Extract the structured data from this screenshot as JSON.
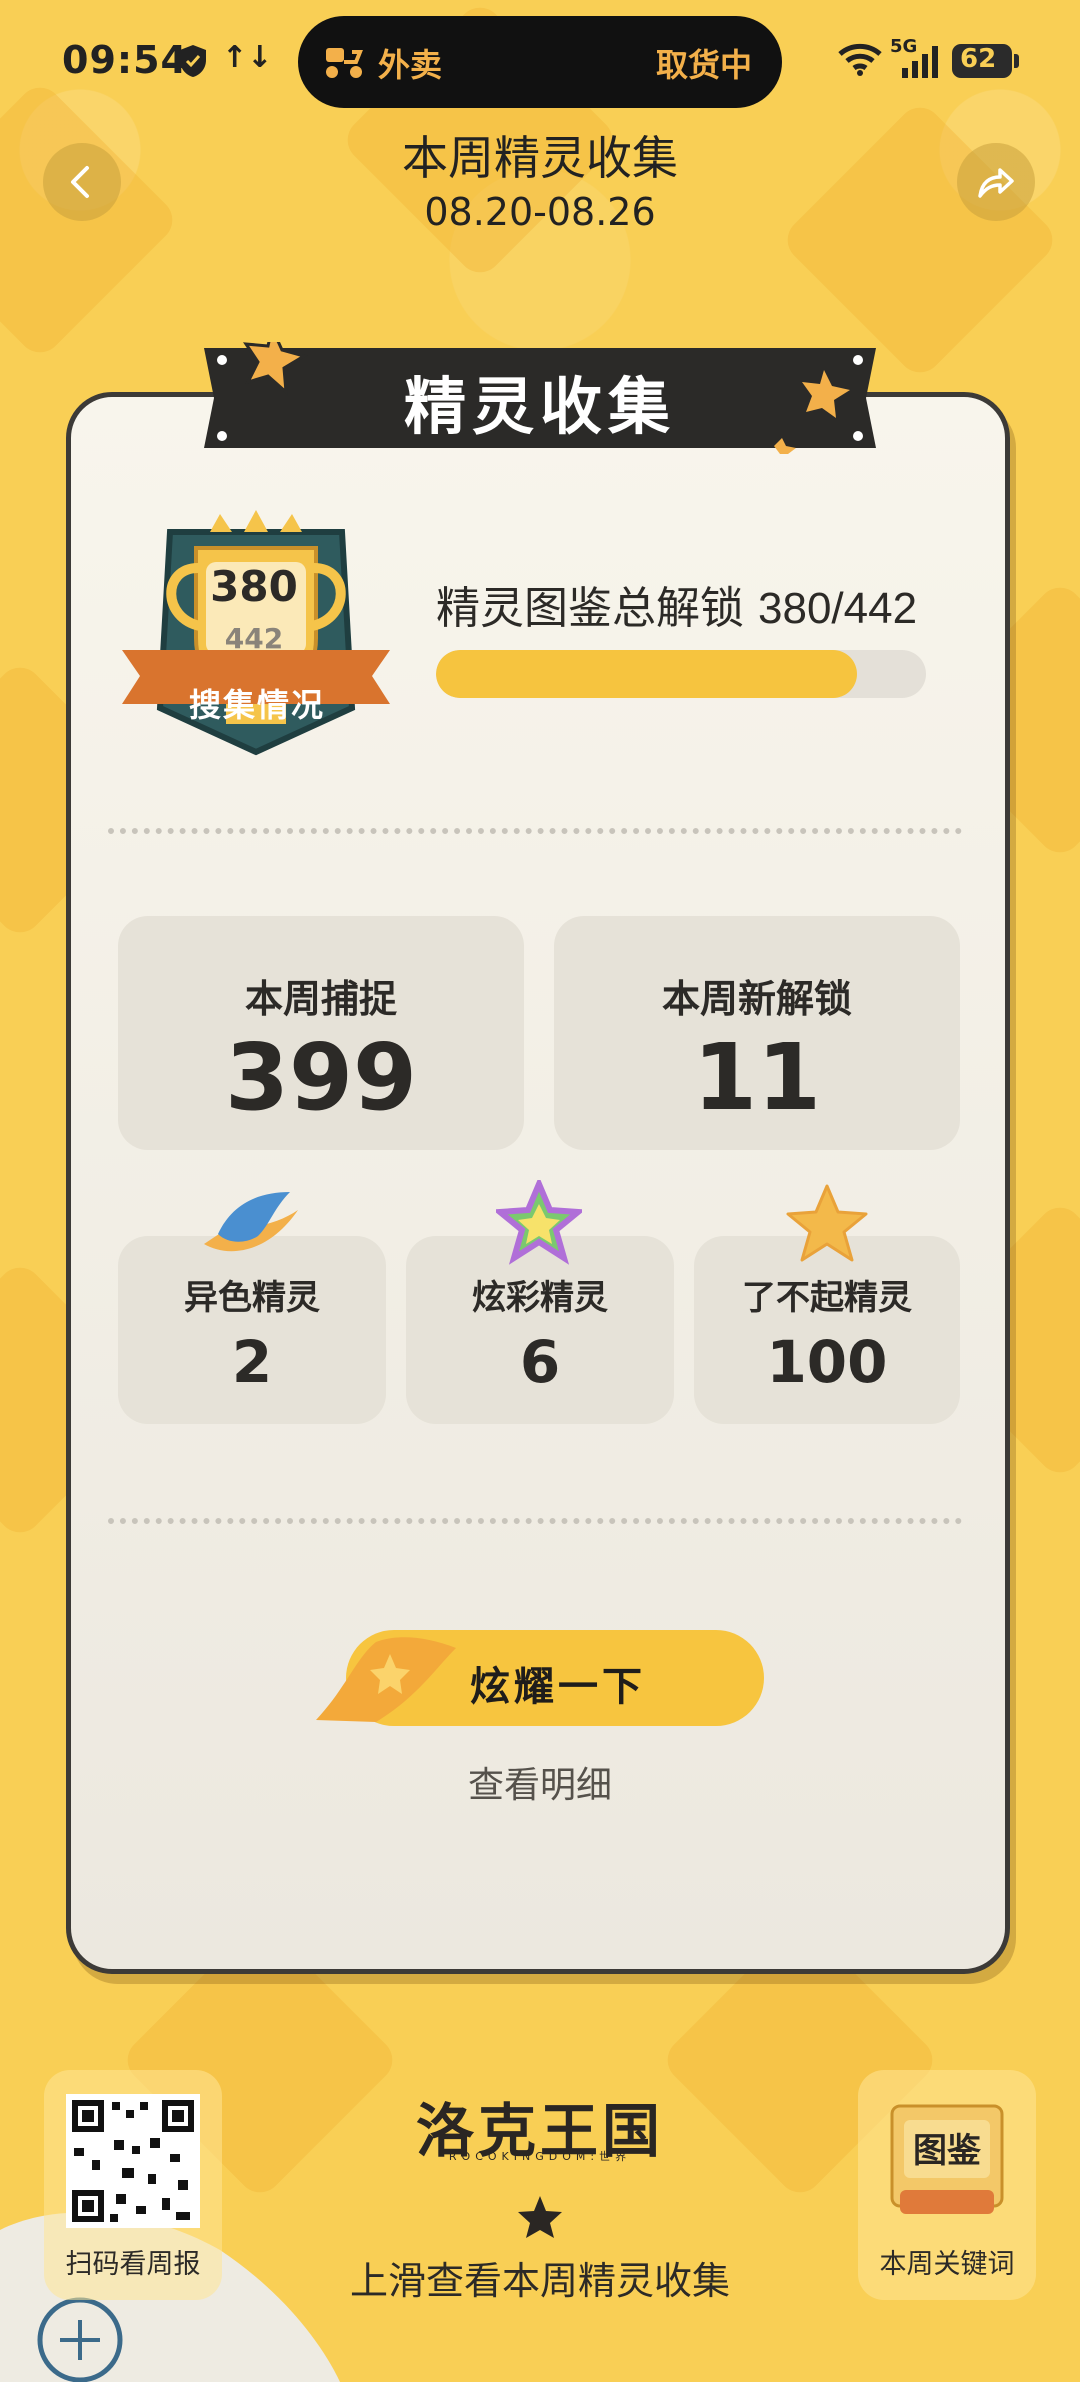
{
  "status_bar": {
    "time": "09:54",
    "data_arrows": "↑↓",
    "pill_left": "外卖",
    "pill_right": "取货中",
    "network": "5G",
    "battery": "62"
  },
  "header": {
    "title": "本周精灵收集",
    "dates": "08.20-08.26"
  },
  "card": {
    "ribbon_title": "精灵收集",
    "trophy": {
      "collected": "380",
      "total": "442",
      "label": "搜集情况"
    },
    "unlock": {
      "label": "精灵图鉴总解锁",
      "value": "380/442",
      "progress": 0.86
    },
    "stats_top": [
      {
        "label": "本周捕捉",
        "value": "399"
      },
      {
        "label": "本周新解锁",
        "value": "11"
      }
    ],
    "stats_bottom": [
      {
        "label": "异色精灵",
        "value": "2",
        "icon": "shiny-icon"
      },
      {
        "label": "炫彩精灵",
        "value": "6",
        "icon": "rainbow-star-icon"
      },
      {
        "label": "了不起精灵",
        "value": "100",
        "icon": "gold-star-icon"
      }
    ],
    "cta_label": "炫耀一下",
    "detail_link": "查看明细"
  },
  "bottom": {
    "qr_label": "扫码看周报",
    "logo": "洛克王国",
    "logo_sub": "ROCOKINGDOM:世界",
    "book_badge": "图鉴",
    "book_label": "本周关键词",
    "swipe_hint": "上滑查看本周精灵收集"
  },
  "colors": {
    "background": "#f9cf55",
    "accent": "#f6c43f",
    "dark": "#2c2a27",
    "card": "#f8f5ec"
  }
}
